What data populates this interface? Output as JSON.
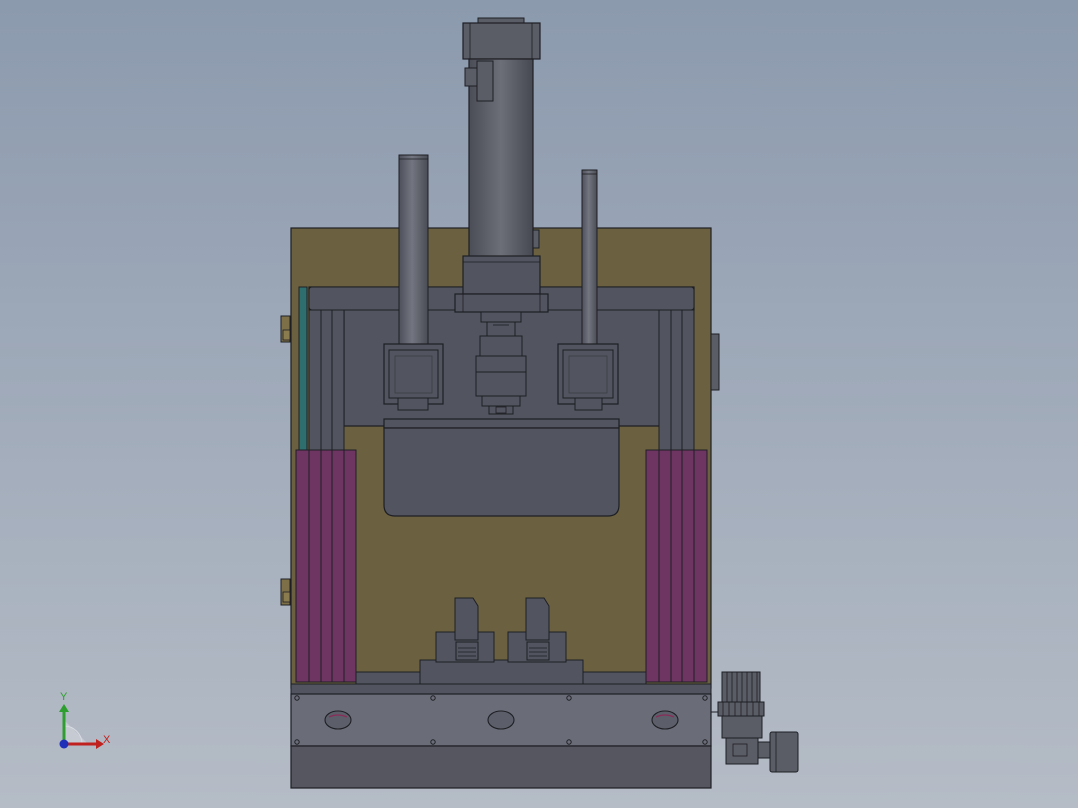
{
  "viewport": {
    "background_top": "#8c9aae",
    "background_bottom": "#b5bcc6"
  },
  "colors": {
    "frame_olive": "#6b6140",
    "plate_gray": "#52545f",
    "rail_magenta": "#6e3562",
    "guide_teal": "#2f6e6e",
    "base_gray": "#6a6c78",
    "base_dark": "#55565f",
    "motor_gray": "#5a5c66",
    "outline": "#1e1f24",
    "axis_x": "#c0201e",
    "axis_y": "#2e9e2e",
    "axis_z": "#1f2fb8"
  },
  "triad": {
    "x_label": "X",
    "y_label": "Y"
  }
}
